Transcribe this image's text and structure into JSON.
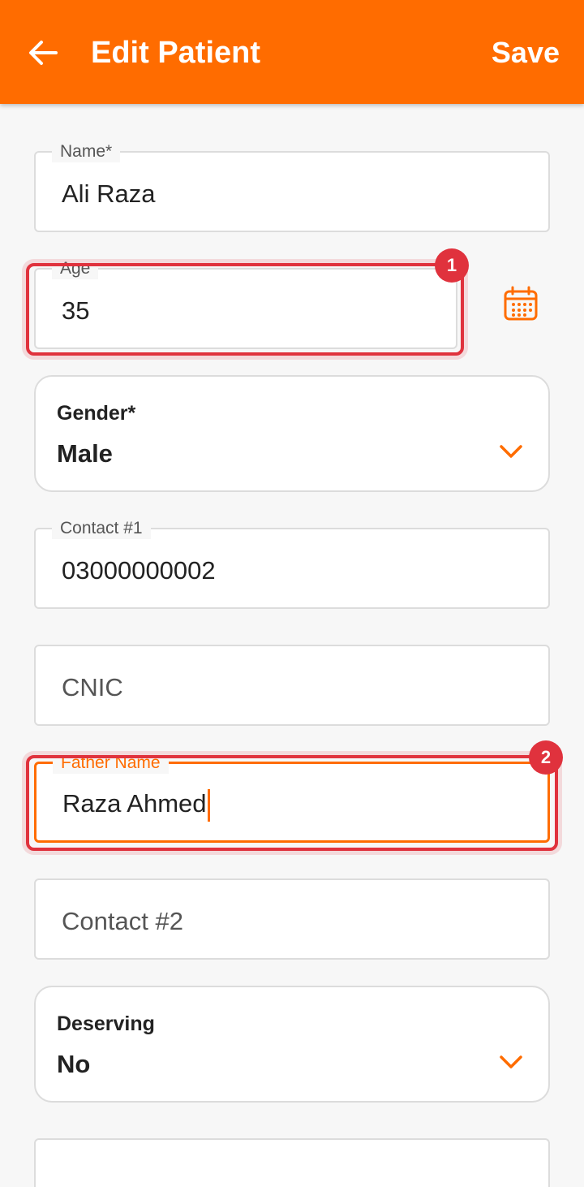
{
  "header": {
    "title": "Edit Patient",
    "save_label": "Save",
    "back_icon": "arrow-left-icon"
  },
  "form": {
    "name": {
      "label": "Name*",
      "value": "Ali Raza"
    },
    "age": {
      "label": "Age",
      "value": "35",
      "calendar_icon": "calendar-icon"
    },
    "gender": {
      "label": "Gender*",
      "value": "Male"
    },
    "contact1": {
      "label": "Contact #1",
      "value": "03000000002"
    },
    "cnic": {
      "placeholder": "CNIC"
    },
    "father_name": {
      "label": "Father Name",
      "value": "Raza Ahmed"
    },
    "contact2": {
      "placeholder": "Contact #2"
    },
    "deserving": {
      "label": "Deserving",
      "value": "No"
    }
  },
  "annotations": {
    "badge_1": "1",
    "badge_2": "2"
  },
  "colors": {
    "primary": "#ff6c00",
    "highlight": "#e0323d",
    "background": "#f7f7f7"
  }
}
